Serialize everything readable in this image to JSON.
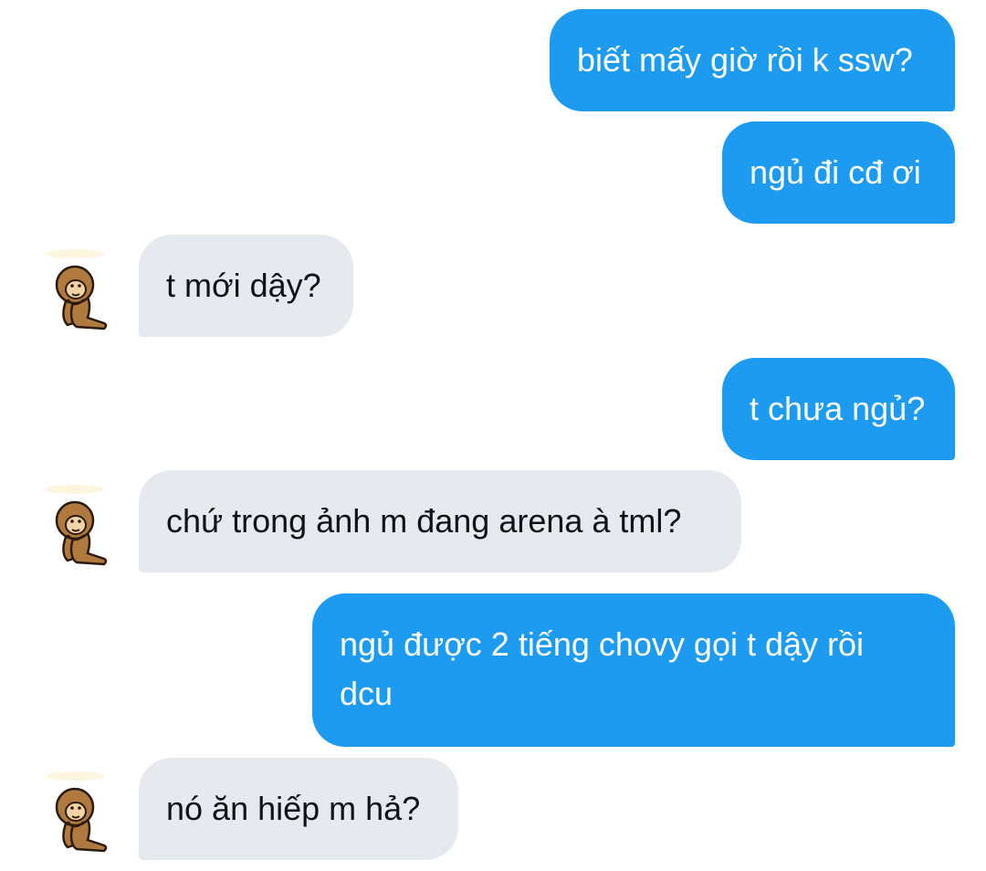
{
  "colors": {
    "sent_bubble": "#1d9bf0",
    "received_bubble": "#e6e9ed",
    "sent_text": "#ffffff",
    "received_text": "#0f1419"
  },
  "avatar_icon": "monkey-avatar-icon",
  "messages": [
    {
      "direction": "sent",
      "text": "biết mấy giờ rồi k ssw?"
    },
    {
      "direction": "sent",
      "text": "ngủ đi cđ ơi"
    },
    {
      "direction": "received",
      "text": "t mới dậy?"
    },
    {
      "direction": "sent",
      "text": "t chưa ngủ?"
    },
    {
      "direction": "received",
      "text": "chứ trong ảnh m đang arena à tml?"
    },
    {
      "direction": "sent",
      "text": "ngủ được 2 tiếng chovy gọi t dậy rồi dcu"
    },
    {
      "direction": "received",
      "text": "nó ăn hiếp m hả?"
    }
  ]
}
